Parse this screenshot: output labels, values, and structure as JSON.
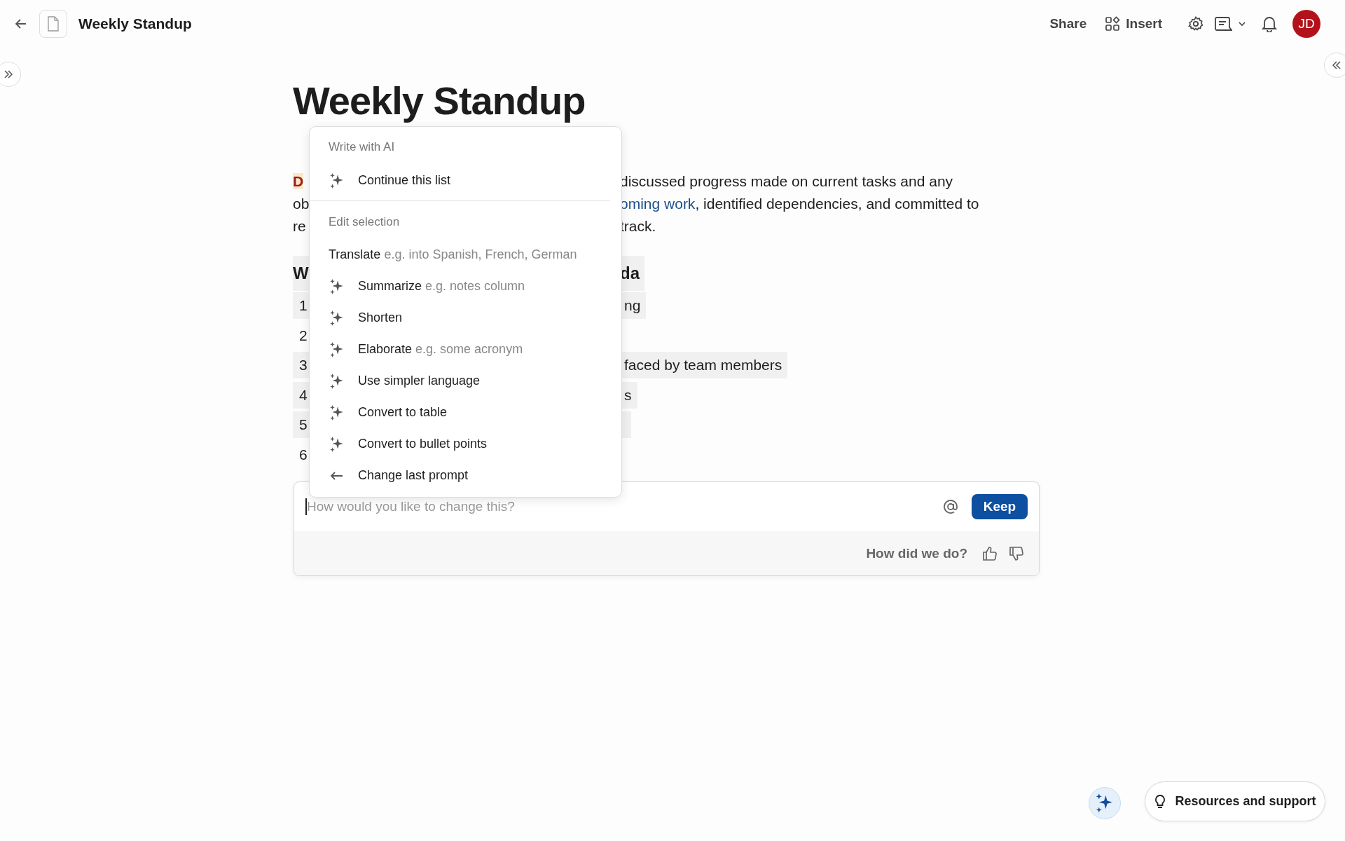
{
  "topbar": {
    "title": "Weekly Standup",
    "share": "Share",
    "insert": "Insert",
    "avatar": "JD"
  },
  "document": {
    "title": "Weekly Standup",
    "paragraph_lines": [
      {
        "left": [
          {
            "text": "D",
            "kind": "mention"
          }
        ],
        "right": [
          {
            "text": "discussed progress made on current tasks and any",
            "kind": "plain"
          }
        ]
      },
      {
        "left": [
          {
            "text": "ob",
            "kind": "plain"
          }
        ],
        "right": [
          {
            "text": "oming work",
            "kind": "link"
          },
          {
            "text": ", identified dependencies, and committed to",
            "kind": "plain"
          }
        ]
      },
      {
        "left": [
          {
            "text": "re",
            "kind": "plain"
          }
        ],
        "right": [
          {
            "text": "track.",
            "kind": "plain"
          }
        ]
      }
    ],
    "heading": {
      "left": "W",
      "right": "da",
      "highlighted": true
    },
    "list": [
      {
        "number": "1",
        "text": "ng",
        "highlighted": true
      },
      {
        "number": "2",
        "highlighted": false
      },
      {
        "number": "3",
        "text": "faced by team members",
        "highlighted": true
      },
      {
        "number": "4",
        "text": "s",
        "highlighted": true
      },
      {
        "number": "5",
        "highlighted": true
      },
      {
        "number": "6",
        "highlighted": false
      }
    ]
  },
  "ai_menu": {
    "sections": [
      {
        "title": "Write with AI",
        "items": [
          {
            "label": "Continue this list",
            "kind": "sparkle"
          }
        ]
      },
      {
        "title": "Edit selection",
        "items": [
          {
            "label": "Translate",
            "hint": "e.g. into Spanish, French, German",
            "kind": "plain"
          },
          {
            "label": "Summarize",
            "hint": "e.g. notes column",
            "kind": "sparkle"
          },
          {
            "label": "Shorten",
            "kind": "sparkle"
          },
          {
            "label": "Elaborate",
            "hint": "e.g. some acronym",
            "kind": "sparkle"
          },
          {
            "label": "Use simpler language",
            "kind": "sparkle"
          },
          {
            "label": "Convert to table",
            "kind": "sparkle"
          },
          {
            "label": "Convert to bullet points",
            "kind": "sparkle"
          },
          {
            "label": "Change last prompt",
            "kind": "return"
          }
        ]
      }
    ]
  },
  "prompt": {
    "placeholder": "How would you like to change this?",
    "keep": "Keep",
    "feedback": "How did we do?"
  },
  "resources": "Resources and support"
}
